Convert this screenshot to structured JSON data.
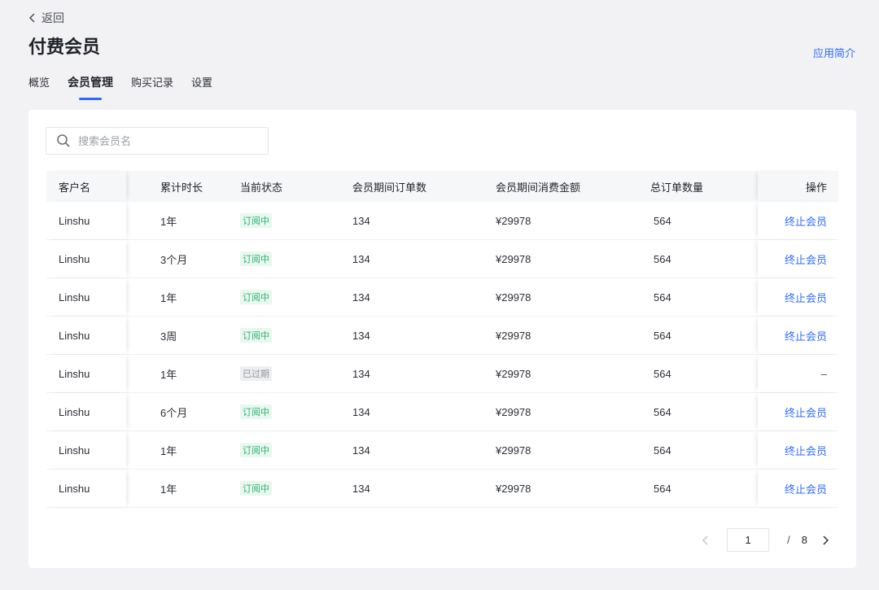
{
  "nav": {
    "back_label": "返回",
    "page_title": "付费会员",
    "app_intro": "应用简介"
  },
  "tabs": [
    {
      "label": "概览",
      "active": false
    },
    {
      "label": "会员管理",
      "active": true
    },
    {
      "label": "购买记录",
      "active": false
    },
    {
      "label": "设置",
      "active": false
    }
  ],
  "search": {
    "placeholder": "搜索会员名",
    "value": ""
  },
  "table": {
    "headers": [
      "客户名",
      "累计时长",
      "当前状态",
      "会员期间订单数",
      "会员期间消费金额",
      "总订单数量",
      "操作"
    ],
    "rows": [
      {
        "name": "Linshu",
        "duration": "1年",
        "status": "订阅中",
        "status_type": "active",
        "orders": "134",
        "amount": "¥29978",
        "total": "564",
        "action": "终止会员"
      },
      {
        "name": "Linshu",
        "duration": "3个月",
        "status": "订阅中",
        "status_type": "active",
        "orders": "134",
        "amount": "¥29978",
        "total": "564",
        "action": "终止会员"
      },
      {
        "name": "Linshu",
        "duration": "1年",
        "status": "订阅中",
        "status_type": "active",
        "orders": "134",
        "amount": "¥29978",
        "total": "564",
        "action": "终止会员"
      },
      {
        "name": "Linshu",
        "duration": "3周",
        "status": "订阅中",
        "status_type": "active",
        "orders": "134",
        "amount": "¥29978",
        "total": "564",
        "action": "终止会员"
      },
      {
        "name": "Linshu",
        "duration": "1年",
        "status": "已过期",
        "status_type": "expired",
        "orders": "134",
        "amount": "¥29978",
        "total": "564",
        "action": "–"
      },
      {
        "name": "Linshu",
        "duration": "6个月",
        "status": "订阅中",
        "status_type": "active",
        "orders": "134",
        "amount": "¥29978",
        "total": "564",
        "action": "终止会员"
      },
      {
        "name": "Linshu",
        "duration": "1年",
        "status": "订阅中",
        "status_type": "active",
        "orders": "134",
        "amount": "¥29978",
        "total": "564",
        "action": "终止会员"
      },
      {
        "name": "Linshu",
        "duration": "1年",
        "status": "订阅中",
        "status_type": "active",
        "orders": "134",
        "amount": "¥29978",
        "total": "564",
        "action": "终止会员"
      }
    ]
  },
  "pagination": {
    "current_page": "1",
    "separator": "/",
    "total_pages": "8"
  },
  "colors": {
    "accent": "#2d6bff",
    "status_active": "#2fb36f",
    "status_expired": "#8f959e"
  }
}
